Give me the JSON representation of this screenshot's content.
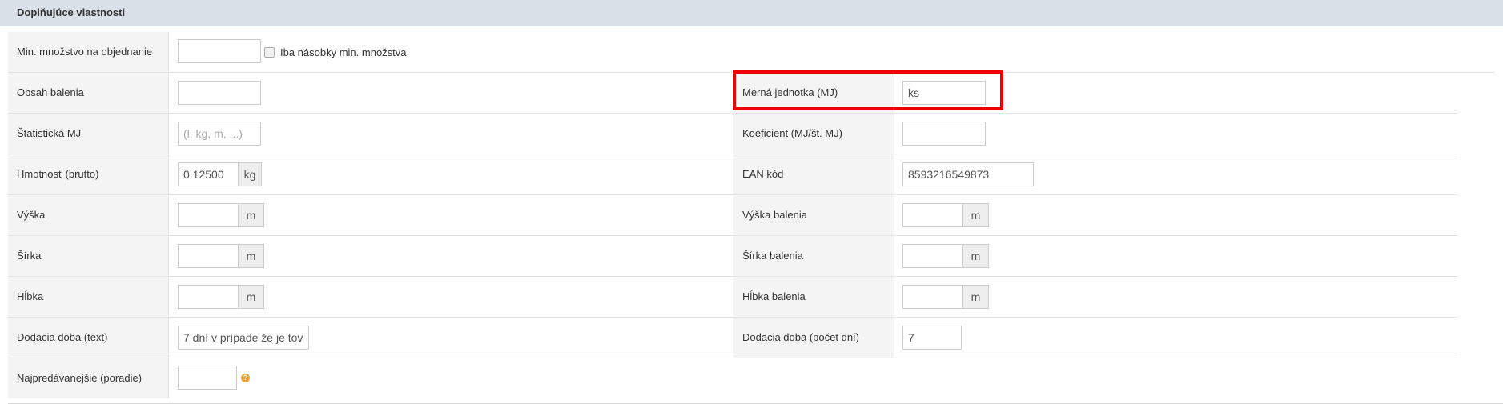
{
  "section": {
    "title": "Doplňujúce vlastnosti"
  },
  "rows": [
    {
      "label": "Min. množstvo na objednanie",
      "value": "",
      "checkbox": {
        "checked": false,
        "label": "Iba násobky min. množstva"
      }
    },
    {
      "label": "Obsah balenia",
      "value": "",
      "right": {
        "label": "Merná jednotka (MJ)",
        "value": "ks"
      }
    },
    {
      "label": "Štatistická MJ",
      "placeholder": "(l, kg, m, ...)",
      "right": {
        "label": "Koeficient (MJ/št. MJ)",
        "value": ""
      }
    },
    {
      "label": "Hmotnosť (brutto)",
      "value": "0.12500",
      "unit": "kg",
      "right": {
        "label": "EAN kód",
        "value": "8593216549873"
      }
    },
    {
      "label": "Výška",
      "value": "",
      "unit": "m",
      "right": {
        "label": "Výška balenia",
        "value": "",
        "unit": "m"
      }
    },
    {
      "label": "Šírka",
      "value": "",
      "unit": "m",
      "right": {
        "label": "Šírka balenia",
        "value": "",
        "unit": "m"
      }
    },
    {
      "label": "Hĺbka",
      "value": "",
      "unit": "m",
      "right": {
        "label": "Hĺbka balenia",
        "value": "",
        "unit": "m"
      }
    },
    {
      "label": "Dodacia doba (text)",
      "value": "7 dní v prípade že je tov",
      "right": {
        "label": "Dodacia doba (počet dní)",
        "value": "7"
      }
    },
    {
      "label": "Najpredávanejšie (poradie)",
      "value": "",
      "help": "?"
    }
  ],
  "colors": {
    "header_bg": "#d9e0e7",
    "label_bg": "#f4f4f4",
    "highlight": "#ee0000",
    "help_icon": "#f0a030"
  }
}
